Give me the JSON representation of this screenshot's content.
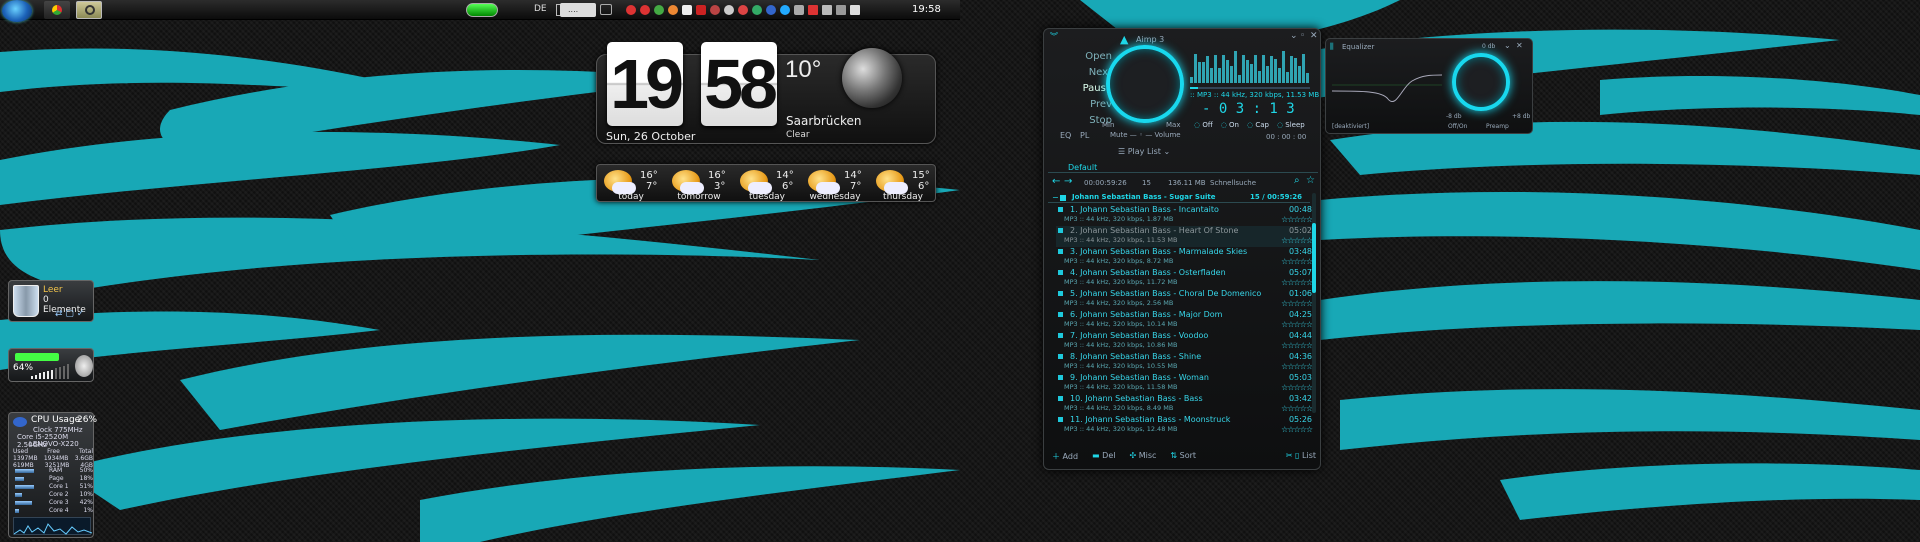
{
  "taskbar": {
    "lang": "DE",
    "clock": "19:58",
    "input_value": "....",
    "icons": [
      "windows-start-icon",
      "chrome-icon",
      "app-icon"
    ]
  },
  "clock_widget": {
    "hour": "19",
    "minute": "58",
    "date": "Sun, 26 October",
    "temp": "10°",
    "city": "Saarbrücken",
    "condition": "Clear"
  },
  "forecast": [
    {
      "day": "today",
      "hi": "16°",
      "lo": "7°"
    },
    {
      "day": "tomorrow",
      "hi": "16°",
      "lo": "3°"
    },
    {
      "day": "tuesday",
      "hi": "14°",
      "lo": "6°"
    },
    {
      "day": "wednesday",
      "hi": "14°",
      "lo": "7°"
    },
    {
      "day": "thursday",
      "hi": "15°",
      "lo": "6°"
    }
  ],
  "recycle": {
    "title": "Leer",
    "count": "0 Elemente"
  },
  "volume": {
    "percent": "64%",
    "level": 0.64
  },
  "cpu": {
    "title": "CPU Usage",
    "value": "26%",
    "clock": "Clock   775MHz",
    "cpu": "Core i5-2520M 2.50GHz",
    "host": "LENOVO-X220",
    "headers": [
      "Used",
      "Free",
      "Total"
    ],
    "mem": [
      [
        "1397MB",
        "1934MB",
        "3.6GB"
      ],
      [
        "619MB",
        "3251MB",
        "4GB"
      ]
    ],
    "rows": [
      [
        "RAM",
        "50%"
      ],
      [
        "Page",
        "18%"
      ],
      [
        "Core 1",
        "51%"
      ],
      [
        "Core 2",
        "10%"
      ],
      [
        "Core 3",
        "42%"
      ],
      [
        "Core 4",
        "1%"
      ]
    ]
  },
  "aimp": {
    "title": "Aimp 3",
    "menu": [
      "Open",
      "Next",
      "Pause",
      "Prev",
      "Stop"
    ],
    "eq": "EQ",
    "pl": "PL",
    "min": "Min",
    "max": "Max",
    "mute_volume": "Mute — ◦ — Volume",
    "format": ":: MP3 :: 44 kHz, 320 kbps, 11.53 MB",
    "time": "- 0 3 :  1 3",
    "opts": [
      "Off",
      "On",
      "Cap",
      "Sleep"
    ],
    "opt_time": "00 : 00 : 00",
    "playlist_menu": "Play List",
    "tab": "Default",
    "info_time": "00:00:59:26",
    "info_count": "15",
    "info_size": "136.11 MB",
    "search": "Schnellsuche",
    "album": "Johann Sebastian Bass - Sugar Suite",
    "album_info": "15 / 00:59:26",
    "tracks": [
      {
        "t": "1. Johann Sebastian Bass - Incantaito",
        "d": "00:48",
        "m": "MP3 :: 44 kHz, 320 kbps, 1.87 MB"
      },
      {
        "t": "2. Johann Sebastian Bass - Heart Of Stone",
        "d": "05:02",
        "m": "MP3 :: 44 kHz, 320 kbps, 11.53 MB"
      },
      {
        "t": "3. Johann Sebastian Bass - Marmalade Skies",
        "d": "03:48",
        "m": "MP3 :: 44 kHz, 320 kbps, 8.72 MB"
      },
      {
        "t": "4. Johann Sebastian Bass - Osterfladen",
        "d": "05:07",
        "m": "MP3 :: 44 kHz, 320 kbps, 11.72 MB"
      },
      {
        "t": "5. Johann Sebastian Bass - Choral De Domenico",
        "d": "01:06",
        "m": "MP3 :: 44 kHz, 320 kbps, 2.56 MB"
      },
      {
        "t": "6. Johann Sebastian Bass - Major Dom",
        "d": "04:25",
        "m": "MP3 :: 44 kHz, 320 kbps, 10.14 MB"
      },
      {
        "t": "7. Johann Sebastian Bass - Voodoo",
        "d": "04:44",
        "m": "MP3 :: 44 kHz, 320 kbps, 10.86 MB"
      },
      {
        "t": "8. Johann Sebastian Bass - Shine",
        "d": "04:36",
        "m": "MP3 :: 44 kHz, 320 kbps, 10.55 MB"
      },
      {
        "t": "9. Johann Sebastian Bass - Woman",
        "d": "05:03",
        "m": "MP3 :: 44 kHz, 320 kbps, 11.58 MB"
      },
      {
        "t": "10. Johann Sebastian Bass - Bass",
        "d": "03:42",
        "m": "MP3 :: 44 kHz, 320 kbps, 8.49 MB"
      },
      {
        "t": "11. Johann Sebastian Bass - Moonstruck",
        "d": "05:26",
        "m": "MP3 :: 44 kHz, 320 kbps, 12.48 MB"
      }
    ],
    "bottom": [
      "Add",
      "Del",
      "Misc",
      "Sort",
      "List"
    ]
  },
  "equalizer": {
    "title": "Equalizer",
    "db_top": "0 db",
    "db_left": "-8 db",
    "db_right": "+8 db",
    "status": "[deaktiviert]",
    "off_on": "Off/On",
    "preamp": "Preamp"
  },
  "colors": {
    "accent": "#1fd6e6",
    "stripe": "#16a3b3"
  }
}
